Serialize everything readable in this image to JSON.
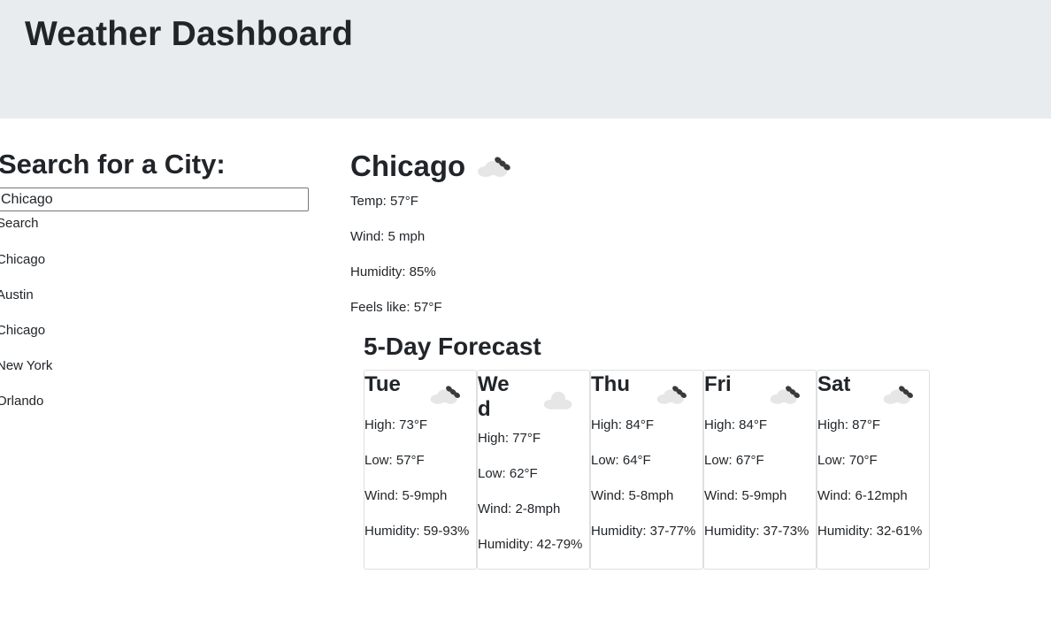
{
  "header": {
    "title": "Weather Dashboard"
  },
  "search": {
    "heading": "Search for a City:",
    "input_value": "Chicago",
    "button_label": "Search",
    "history": [
      "Chicago",
      "Austin",
      "Chicago",
      "New York",
      "Orlando"
    ]
  },
  "current": {
    "city": "Chicago",
    "icon": "cloudy-rain-icon",
    "temp": "Temp: 57°F",
    "wind": "Wind: 5 mph",
    "humidity": "Humidity: 85%",
    "feels_like": "Feels like: 57°F"
  },
  "forecast": {
    "title": "5-Day Forecast",
    "days": [
      {
        "day": "Tue",
        "icon": "cloudy-rain-icon",
        "high": "High: 73°F",
        "low": "Low: 57°F",
        "wind": "Wind: 5-9mph",
        "humidity": "Humidity: 59-93%"
      },
      {
        "day": "Wed",
        "icon": "cloud-icon",
        "high": "High: 77°F",
        "low": "Low: 62°F",
        "wind": "Wind: 2-8mph",
        "humidity": "Humidity: 42-79%"
      },
      {
        "day": "Thu",
        "icon": "cloudy-rain-icon",
        "high": "High: 84°F",
        "low": "Low: 64°F",
        "wind": "Wind: 5-8mph",
        "humidity": "Humidity: 37-77%"
      },
      {
        "day": "Fri",
        "icon": "cloudy-rain-icon",
        "high": "High: 84°F",
        "low": "Low: 67°F",
        "wind": "Wind: 5-9mph",
        "humidity": "Humidity: 37-73%"
      },
      {
        "day": "Sat",
        "icon": "cloudy-rain-icon",
        "high": "High: 87°F",
        "low": "Low: 70°F",
        "wind": "Wind: 6-12mph",
        "humidity": "Humidity: 32-61%"
      }
    ]
  },
  "colors": {
    "header_bg": "#e9ecef",
    "text": "#212529",
    "cloud": "#e6e6e6",
    "rain": "#3a3a3a"
  }
}
